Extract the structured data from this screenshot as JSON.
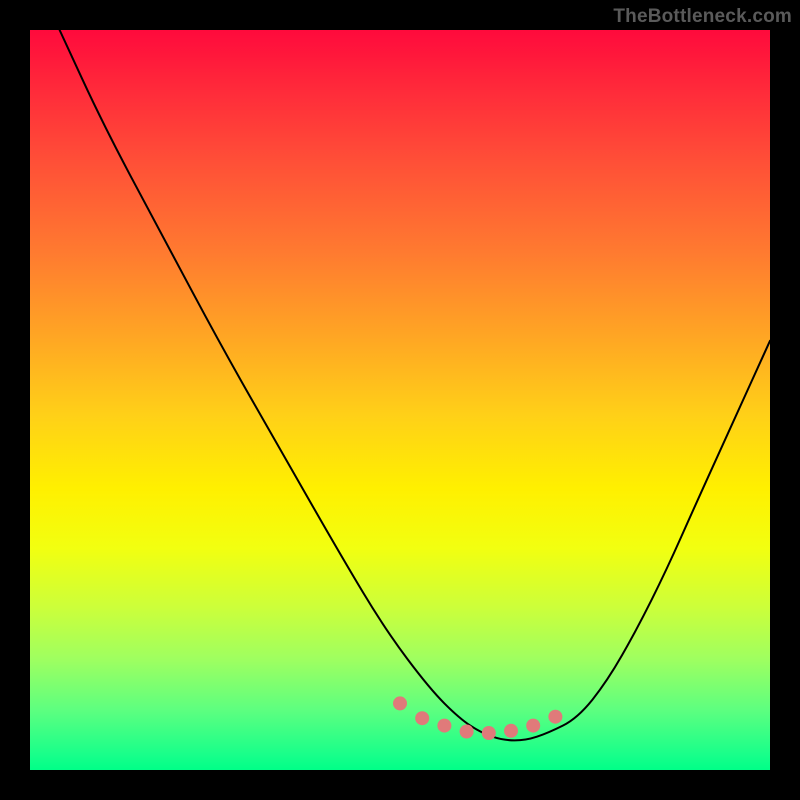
{
  "credit": "TheBottleneck.com",
  "colors": {
    "dot": "#e07a7a",
    "curve": "#000000",
    "frame": "#000000"
  },
  "chart_data": {
    "type": "line",
    "title": "",
    "xlabel": "",
    "ylabel": "",
    "xlim": [
      0,
      100
    ],
    "ylim": [
      0,
      100
    ],
    "grid": false,
    "legend": false,
    "series": [
      {
        "name": "bottleneck-curve",
        "x": [
          4,
          10,
          18,
          26,
          34,
          42,
          48,
          54,
          58,
          61,
          64,
          67,
          70,
          74,
          78,
          82,
          86,
          90,
          95,
          100
        ],
        "y": [
          100,
          87,
          72,
          57,
          43,
          29,
          19,
          11,
          7,
          5,
          4,
          4,
          5,
          7,
          12,
          19,
          27,
          36,
          47,
          58
        ]
      }
    ],
    "highlight_dots": {
      "name": "valley-dots",
      "x": [
        50,
        53,
        56,
        59,
        62,
        65,
        68,
        71
      ],
      "y": [
        9,
        7,
        6,
        5.2,
        5,
        5.3,
        6,
        7.2
      ]
    }
  }
}
